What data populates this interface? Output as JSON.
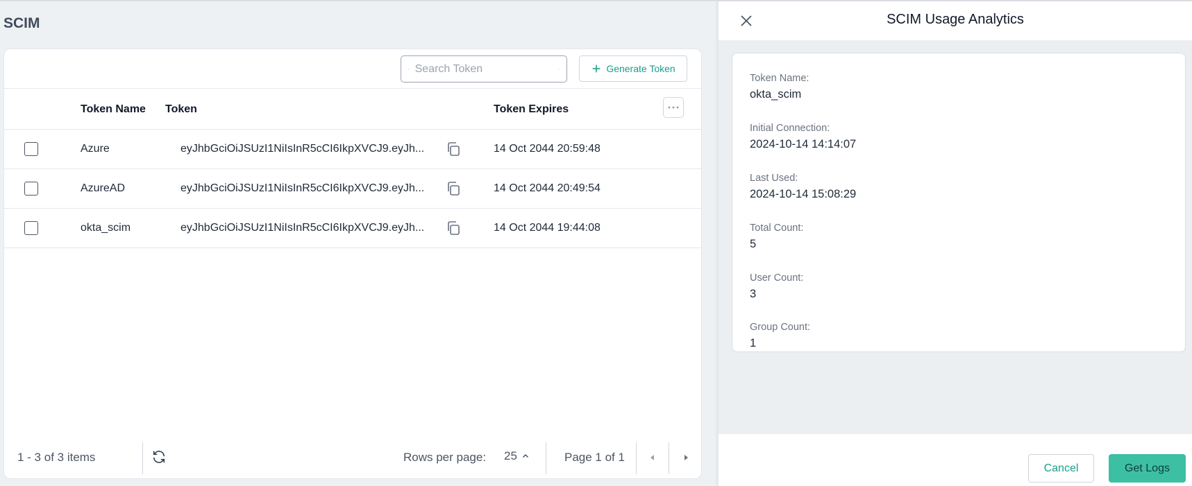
{
  "page": {
    "title": "SCIM"
  },
  "toolbar": {
    "search_placeholder": "Search Token",
    "generate_label": "Generate Token"
  },
  "table": {
    "columns": [
      "Token Name",
      "Token",
      "Token Expires"
    ],
    "rows": [
      {
        "name": "Azure",
        "token": "eyJhbGciOiJSUzI1NiIsInR5cCI6IkpXVCJ9.eyJh...",
        "expires": "14 Oct 2044 20:59:48"
      },
      {
        "name": "AzureAD",
        "token": "eyJhbGciOiJSUzI1NiIsInR5cCI6IkpXVCJ9.eyJh...",
        "expires": "14 Oct 2044 20:49:54"
      },
      {
        "name": "okta_scim",
        "token": "eyJhbGciOiJSUzI1NiIsInR5cCI6IkpXVCJ9.eyJh...",
        "expires": "14 Oct 2044 19:44:08"
      }
    ]
  },
  "footer": {
    "items_text": "1 - 3 of 3 items",
    "rows_per_page_label": "Rows per page:",
    "rows_per_page_value": "25",
    "page_text": "Page 1 of 1"
  },
  "panel": {
    "title": "SCIM Usage Analytics",
    "fields": [
      {
        "label": "Token Name:",
        "value": "okta_scim"
      },
      {
        "label": "Initial Connection:",
        "value": "2024-10-14 14:14:07"
      },
      {
        "label": "Last Used:",
        "value": "2024-10-14 15:08:29"
      },
      {
        "label": "Total Count:",
        "value": "5"
      },
      {
        "label": "User Count:",
        "value": "3"
      },
      {
        "label": "Group Count:",
        "value": "1"
      }
    ],
    "cancel_label": "Cancel",
    "get_logs_label": "Get Logs"
  },
  "colors": {
    "accent": "#1a9e8a",
    "primary_button": "#3dbfa4"
  }
}
